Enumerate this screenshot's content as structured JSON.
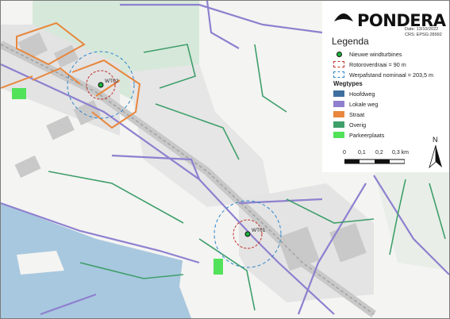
{
  "brand": {
    "name": "PONDERA"
  },
  "meta": {
    "date": "Date: 13/10/2022",
    "crs": "CRS: EPSG:28992"
  },
  "legend": {
    "title": "Legenda",
    "items": [
      {
        "label": "Nieuwe windturbines",
        "color": "#1db33c"
      },
      {
        "label": "Rotoroverdraai = 90 m",
        "color": "#c0302a"
      },
      {
        "label": "Werpafstand nominaal = 203,5 m",
        "color": "#2e86c8"
      }
    ],
    "wegtypes_title": "Wegtypes",
    "wegtypes": [
      {
        "label": "Hoofdweg",
        "color": "#3f6f9f"
      },
      {
        "label": "Lokale weg",
        "color": "#8e80cf"
      },
      {
        "label": "Straat",
        "color": "#e8873d"
      },
      {
        "label": "Overig",
        "color": "#3f9f6b"
      },
      {
        "label": "Parkeerplaats",
        "color": "#52e25a"
      }
    ]
  },
  "scalebar": {
    "labels": [
      "0",
      "0,1",
      "0,2",
      "0,3 km"
    ]
  },
  "north": {
    "label": "N"
  },
  "turbines": [
    {
      "id": "WT02"
    },
    {
      "id": "WT01"
    }
  ],
  "colors": {
    "water": "#a8c8df",
    "land": "#f4f4f2",
    "green_area": "#d6e8da",
    "lot": "#dfdfdf",
    "building": "#c6c6c6"
  }
}
